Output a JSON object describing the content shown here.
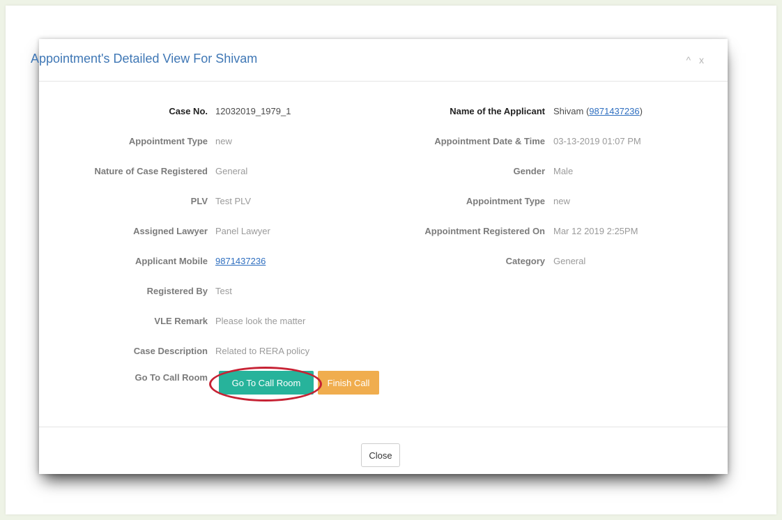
{
  "modal": {
    "title": "Appointment's Detailed View For Shivam",
    "minimize_icon": "^",
    "close_icon": "x"
  },
  "left_fields": [
    {
      "label": "Case No.",
      "value": "12032019_1979_1"
    },
    {
      "label": "Appointment Type",
      "value": "new"
    },
    {
      "label": "Nature of Case Registered",
      "value": "General"
    },
    {
      "label": "PLV",
      "value": "Test PLV"
    },
    {
      "label": "Assigned Lawyer",
      "value": "Panel Lawyer"
    },
    {
      "label": "Applicant Mobile",
      "value": "9871437236"
    },
    {
      "label": "Registered By",
      "value": "Test"
    },
    {
      "label": "VLE Remark",
      "value": "Please look the matter"
    },
    {
      "label": "Case Description",
      "value": "Related to RERA policy"
    },
    {
      "label": "Go To Call Room"
    }
  ],
  "right_fields": [
    {
      "label": "Name of the Applicant",
      "value_prefix": "Shivam (",
      "value_link": "9871437236",
      "value_suffix": ")"
    },
    {
      "label": "Appointment Date & Time",
      "value": "03-13-2019 01:07 PM"
    },
    {
      "label": "Gender",
      "value": "Male"
    },
    {
      "label": "Appointment Type",
      "value": "new"
    },
    {
      "label": "Appointment Registered On",
      "value": "Mar 12 2019 2:25PM"
    },
    {
      "label": "Category",
      "value": "General"
    }
  ],
  "buttons": {
    "call_room": "Go To Call Room",
    "finish_call": "Finish Call",
    "close": "Close"
  },
  "colors": {
    "title": "#3f77b5",
    "call_button": "#27b39b",
    "finish_button": "#f0ad4e",
    "annotation_circle": "#c62234",
    "link": "#2f6fc0"
  }
}
